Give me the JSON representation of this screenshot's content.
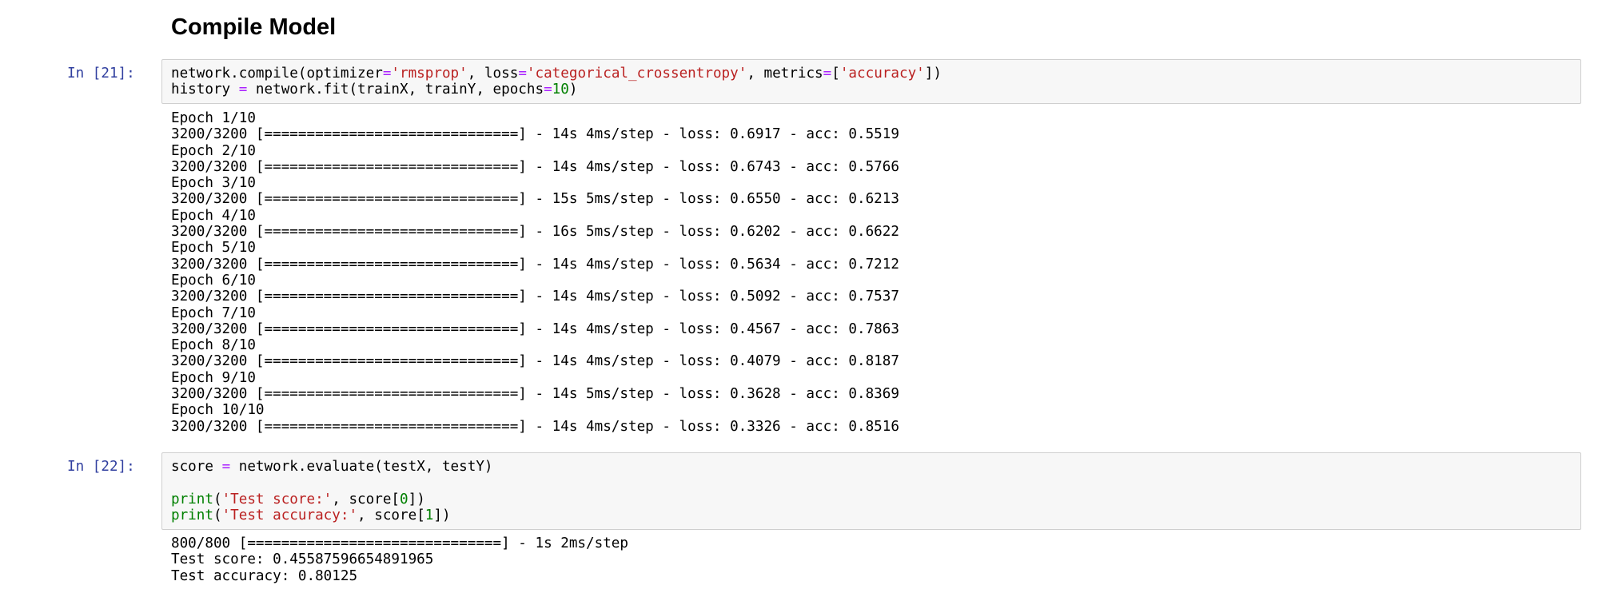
{
  "section_title": "Compile Model",
  "cells": [
    {
      "prompt": "In [21]:",
      "code_lines": [
        [
          {
            "t": "network.compile(optimizer",
            "c": ""
          },
          {
            "t": "=",
            "c": "o"
          },
          {
            "t": "'rmsprop'",
            "c": "s"
          },
          {
            "t": ", loss",
            "c": ""
          },
          {
            "t": "=",
            "c": "o"
          },
          {
            "t": "'categorical_crossentropy'",
            "c": "s"
          },
          {
            "t": ", metrics",
            "c": ""
          },
          {
            "t": "=",
            "c": "o"
          },
          {
            "t": "[",
            "c": ""
          },
          {
            "t": "'accuracy'",
            "c": "s"
          },
          {
            "t": "])",
            "c": ""
          }
        ],
        [
          {
            "t": "history ",
            "c": ""
          },
          {
            "t": "=",
            "c": "o"
          },
          {
            "t": " network.fit(trainX, trainY, epochs",
            "c": ""
          },
          {
            "t": "=",
            "c": "o"
          },
          {
            "t": "10",
            "c": "n"
          },
          {
            "t": ")",
            "c": ""
          }
        ]
      ],
      "output_lines": [
        "Epoch 1/10",
        "3200/3200 [==============================] - 14s 4ms/step - loss: 0.6917 - acc: 0.5519",
        "Epoch 2/10",
        "3200/3200 [==============================] - 14s 4ms/step - loss: 0.6743 - acc: 0.5766",
        "Epoch 3/10",
        "3200/3200 [==============================] - 15s 5ms/step - loss: 0.6550 - acc: 0.6213",
        "Epoch 4/10",
        "3200/3200 [==============================] - 16s 5ms/step - loss: 0.6202 - acc: 0.6622",
        "Epoch 5/10",
        "3200/3200 [==============================] - 14s 4ms/step - loss: 0.5634 - acc: 0.7212",
        "Epoch 6/10",
        "3200/3200 [==============================] - 14s 4ms/step - loss: 0.5092 - acc: 0.7537",
        "Epoch 7/10",
        "3200/3200 [==============================] - 14s 4ms/step - loss: 0.4567 - acc: 0.7863",
        "Epoch 8/10",
        "3200/3200 [==============================] - 14s 4ms/step - loss: 0.4079 - acc: 0.8187",
        "Epoch 9/10",
        "3200/3200 [==============================] - 14s 5ms/step - loss: 0.3628 - acc: 0.8369",
        "Epoch 10/10",
        "3200/3200 [==============================] - 14s 4ms/step - loss: 0.3326 - acc: 0.8516"
      ]
    },
    {
      "prompt": "In [22]:",
      "code_lines": [
        [
          {
            "t": "score ",
            "c": ""
          },
          {
            "t": "=",
            "c": "o"
          },
          {
            "t": " network.evaluate(testX, testY)",
            "c": ""
          }
        ],
        [],
        [
          {
            "t": "print",
            "c": "k"
          },
          {
            "t": "(",
            "c": ""
          },
          {
            "t": "'Test score:'",
            "c": "s"
          },
          {
            "t": ", score[",
            "c": ""
          },
          {
            "t": "0",
            "c": "n"
          },
          {
            "t": "])",
            "c": ""
          }
        ],
        [
          {
            "t": "print",
            "c": "k"
          },
          {
            "t": "(",
            "c": ""
          },
          {
            "t": "'Test accuracy:'",
            "c": "s"
          },
          {
            "t": ", score[",
            "c": ""
          },
          {
            "t": "1",
            "c": "n"
          },
          {
            "t": "])",
            "c": ""
          }
        ]
      ],
      "output_lines": [
        "800/800 [==============================] - 1s 2ms/step",
        "Test score: 0.45587596654891965",
        "Test accuracy: 0.80125"
      ]
    }
  ],
  "colors": {
    "prompt": "#303f9f",
    "operator": "#aa22ff",
    "string": "#ba2121",
    "number": "#008000",
    "builtin": "#008000",
    "input_background": "#f7f7f7",
    "input_border": "#cfcfcf"
  }
}
